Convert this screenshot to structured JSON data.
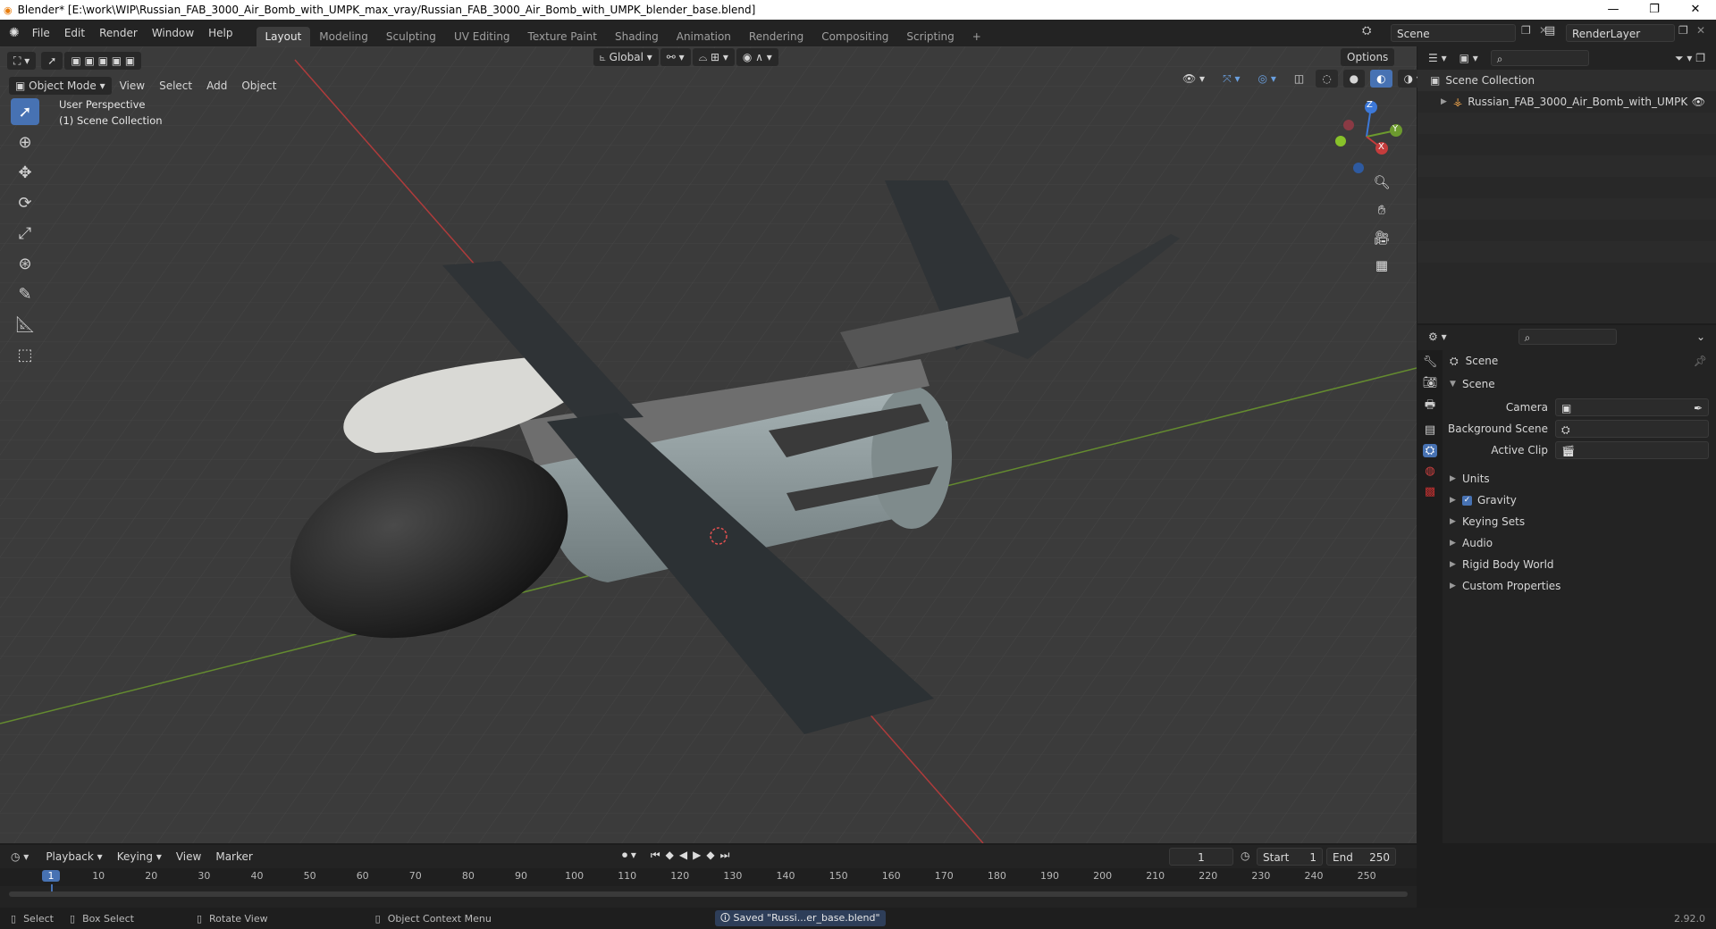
{
  "window": {
    "title": "Blender* [E:\\work\\WIP\\Russian_FAB_3000_Air_Bomb_with_UMPK_max_vray/Russian_FAB_3000_Air_Bomb_with_UMPK_blender_base.blend]",
    "controls": [
      "—",
      "❐",
      "✕"
    ]
  },
  "menu": [
    "File",
    "Edit",
    "Render",
    "Window",
    "Help"
  ],
  "workspaces": [
    {
      "label": "Layout",
      "active": true
    },
    {
      "label": "Modeling"
    },
    {
      "label": "Sculpting"
    },
    {
      "label": "UV Editing"
    },
    {
      "label": "Texture Paint"
    },
    {
      "label": "Shading"
    },
    {
      "label": "Animation"
    },
    {
      "label": "Rendering"
    },
    {
      "label": "Compositing"
    },
    {
      "label": "Scripting"
    }
  ],
  "add_workspace": "+",
  "scene_field": "Scene",
  "renderlayer_field": "RenderLayer",
  "viewport": {
    "mode": "Object Mode",
    "menus": [
      "View",
      "Select",
      "Add",
      "Object"
    ],
    "orientation": "Global",
    "options": "Options",
    "overlay_line1": "User Perspective",
    "overlay_line2": "(1) Scene Collection",
    "gizmo": {
      "z": "Z",
      "y": "Y",
      "x": "X"
    }
  },
  "outliner": {
    "root": "Scene Collection",
    "items": [
      "Russian_FAB_3000_Air_Bomb_with_UMPK"
    ]
  },
  "properties": {
    "header": "Scene",
    "section": "Scene",
    "fields": [
      {
        "label": "Camera"
      },
      {
        "label": "Background Scene"
      },
      {
        "label": "Active Clip"
      }
    ],
    "panels": [
      {
        "label": "Units"
      },
      {
        "label": "Gravity",
        "checkbox": true
      },
      {
        "label": "Keying Sets"
      },
      {
        "label": "Audio"
      },
      {
        "label": "Rigid Body World"
      },
      {
        "label": "Custom Properties"
      }
    ]
  },
  "timeline": {
    "menus": [
      "Playback",
      "Keying",
      "View",
      "Marker"
    ],
    "current_frame": "1",
    "start_label": "Start",
    "start": "1",
    "end_label": "End",
    "end": "250",
    "ticks": [
      "1",
      "10",
      "20",
      "30",
      "40",
      "50",
      "60",
      "70",
      "80",
      "90",
      "100",
      "110",
      "120",
      "130",
      "140",
      "150",
      "160",
      "170",
      "180",
      "190",
      "200",
      "210",
      "220",
      "230",
      "240",
      "250"
    ]
  },
  "statusbar": {
    "select": "Select",
    "box_select": "Box Select",
    "rotate": "Rotate View",
    "context": "Object Context Menu",
    "message": "Saved \"Russi...er_base.blend\"",
    "version": "2.92.0"
  },
  "colors": {
    "accent": "#4772b3",
    "x_axis": "#c43c3c",
    "y_axis": "#6c9a2e",
    "z_axis": "#3c78d8"
  }
}
